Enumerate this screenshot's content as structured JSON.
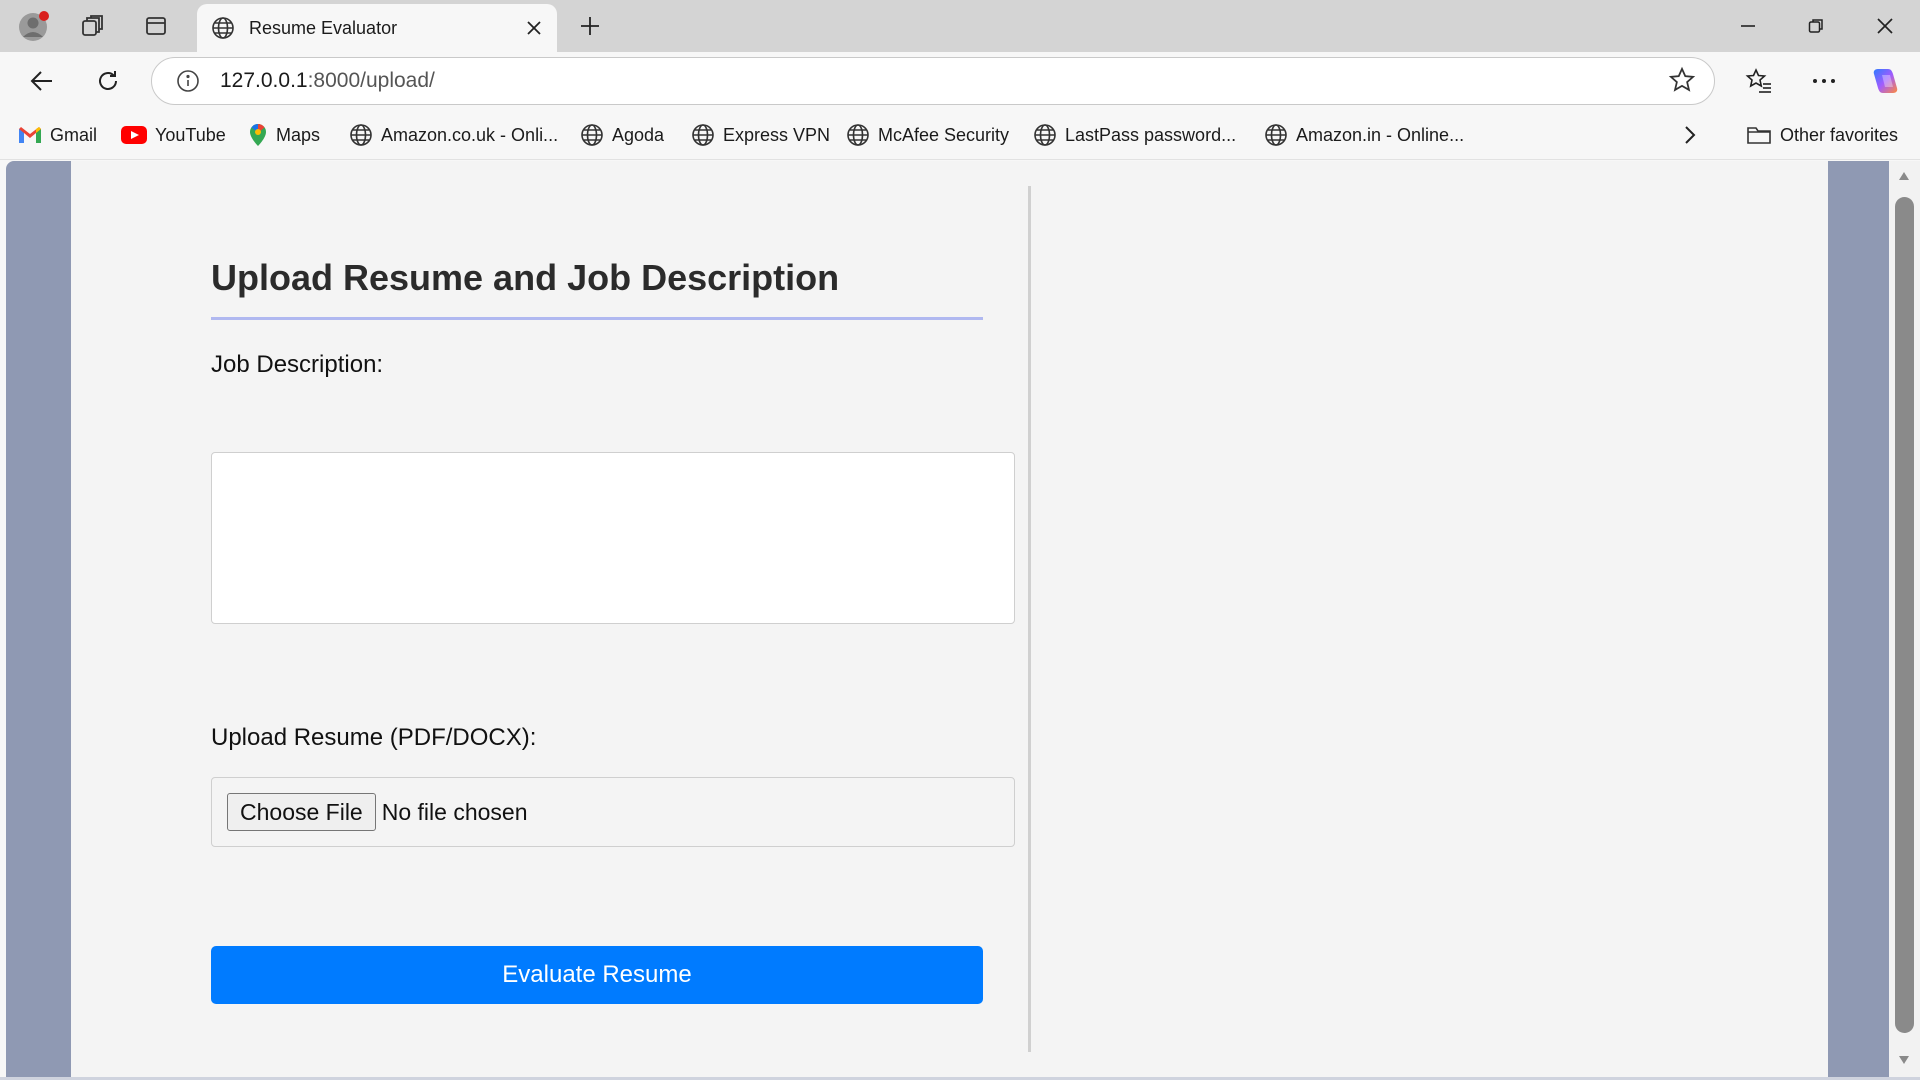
{
  "browser": {
    "tab": {
      "title": "Resume Evaluator"
    },
    "address": {
      "host": "127.0.0.1",
      "rest": ":8000/upload/"
    },
    "favorites": [
      {
        "label": "Gmail",
        "icon": "gmail-icon"
      },
      {
        "label": "YouTube",
        "icon": "youtube-icon"
      },
      {
        "label": "Maps",
        "icon": "maps-icon"
      },
      {
        "label": "Amazon.co.uk - Onli...",
        "icon": "globe-icon"
      },
      {
        "label": "Agoda",
        "icon": "globe-icon"
      },
      {
        "label": "Express VPN",
        "icon": "globe-icon"
      },
      {
        "label": "McAfee Security",
        "icon": "globe-icon"
      },
      {
        "label": "LastPass password...",
        "icon": "globe-icon"
      },
      {
        "label": "Amazon.in - Online...",
        "icon": "globe-icon"
      }
    ],
    "other_favorites": "Other favorites"
  },
  "page": {
    "title": "Upload Resume and Job Description",
    "job_description_label": "Job Description:",
    "job_description_value": "",
    "resume_label": "Upload Resume (PDF/DOCX):",
    "choose_file_label": "Choose File",
    "file_status": "No file chosen",
    "submit_label": "Evaluate Resume"
  },
  "colors": {
    "accent": "#007bff",
    "underline": "#b0b8f0",
    "backdrop": "#8f99b3"
  }
}
